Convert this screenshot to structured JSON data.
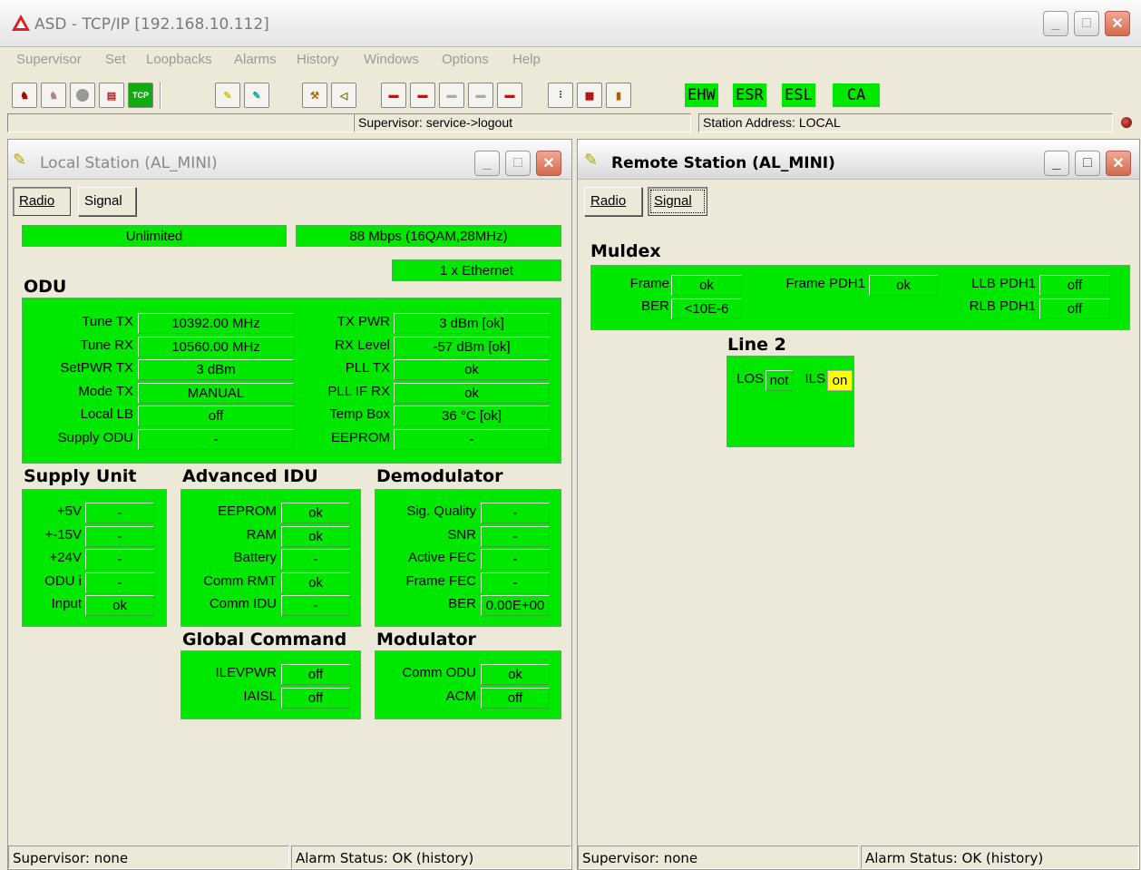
{
  "app": {
    "title": "ASD - TCP/IP [192.168.10.112]",
    "menu": [
      "Supervisor",
      "Set",
      "Loopbacks",
      "Alarms",
      "History",
      "Windows",
      "Options",
      "Help"
    ],
    "alarm_flags": [
      "EHW",
      "ESR",
      "ESL",
      "CA"
    ],
    "toolbar_labels": {
      "tcp": "TCP"
    },
    "status_supervisor": "Supervisor: service->logout",
    "status_station": "Station Address: LOCAL",
    "colors": {
      "ok_green": "#00e800",
      "warn_yellow": "#ffff00"
    }
  },
  "local": {
    "title": "Local Station (AL_MINI)",
    "tabs": {
      "radio": "Radio",
      "signal": "Signal"
    },
    "capacity": "Unlimited",
    "rate": "88 Mbps (16QAM,28MHz)",
    "ethernet": "1 x Ethernet",
    "odu_title": "ODU",
    "odu_left": [
      {
        "label": "Tune TX",
        "value": "10392.00 MHz"
      },
      {
        "label": "Tune RX",
        "value": "10560.00 MHz"
      },
      {
        "label": "SetPWR TX",
        "value": "3 dBm"
      },
      {
        "label": "Mode TX",
        "value": "MANUAL"
      },
      {
        "label": "Local LB",
        "value": "off"
      },
      {
        "label": "Supply ODU",
        "value": "-"
      }
    ],
    "odu_right": [
      {
        "label": "TX PWR",
        "value": "3 dBm [ok]"
      },
      {
        "label": "RX Level",
        "value": "-57 dBm [ok]"
      },
      {
        "label": "PLL TX",
        "value": "ok"
      },
      {
        "label": "PLL IF RX",
        "value": "ok"
      },
      {
        "label": "Temp Box",
        "value": "36 °C [ok]"
      },
      {
        "label": "EEPROM",
        "value": "-"
      }
    ],
    "supply": {
      "title": "Supply Unit",
      "rows": [
        {
          "label": "+5V",
          "value": "-"
        },
        {
          "label": "+-15V",
          "value": "-"
        },
        {
          "label": "+24V",
          "value": "-"
        },
        {
          "label": "ODU i",
          "value": "-"
        },
        {
          "label": "Input",
          "value": "ok"
        }
      ]
    },
    "adv_idu": {
      "title": "Advanced IDU",
      "rows": [
        {
          "label": "EEPROM",
          "value": "ok"
        },
        {
          "label": "RAM",
          "value": "ok"
        },
        {
          "label": "Battery",
          "value": "-"
        },
        {
          "label": "Comm RMT",
          "value": "ok"
        },
        {
          "label": "Comm IDU",
          "value": "-"
        }
      ]
    },
    "demod": {
      "title": "Demodulator",
      "rows": [
        {
          "label": "Sig. Quality",
          "value": "-"
        },
        {
          "label": "SNR",
          "value": "-"
        },
        {
          "label": "Active FEC",
          "value": "-"
        },
        {
          "label": "Frame FEC",
          "value": "-"
        },
        {
          "label": "BER",
          "value": "0.00E+00"
        }
      ]
    },
    "global": {
      "title": "Global Command",
      "rows": [
        {
          "label": "ILEVPWR",
          "value": "off"
        },
        {
          "label": "IAISL",
          "value": "off"
        }
      ]
    },
    "mod": {
      "title": "Modulator",
      "rows": [
        {
          "label": "Comm ODU",
          "value": "ok"
        },
        {
          "label": "ACM",
          "value": "off"
        }
      ]
    },
    "status_supervisor": "Supervisor: none",
    "status_alarm": "Alarm Status: OK (history)"
  },
  "remote": {
    "title": "Remote Station (AL_MINI)",
    "tabs": {
      "radio": "Radio",
      "signal": "Signal"
    },
    "muldex_title": "Muldex",
    "muldex": {
      "frame_label": "Frame",
      "frame_value": "ok",
      "ber_label": "BER",
      "ber_value": "<10E-6",
      "frame_pdh1_label": "Frame PDH1",
      "frame_pdh1_value": "ok",
      "llb_label": "LLB PDH1",
      "llb_value": "off",
      "rlb_label": "RLB PDH1",
      "rlb_value": "off"
    },
    "line2_title": "Line 2",
    "line2": {
      "los_label": "LOS",
      "los_value": "not",
      "ils_label": "ILS",
      "ils_value": "on"
    },
    "status_supervisor": "Supervisor: none",
    "status_alarm": "Alarm Status: OK (history)"
  }
}
